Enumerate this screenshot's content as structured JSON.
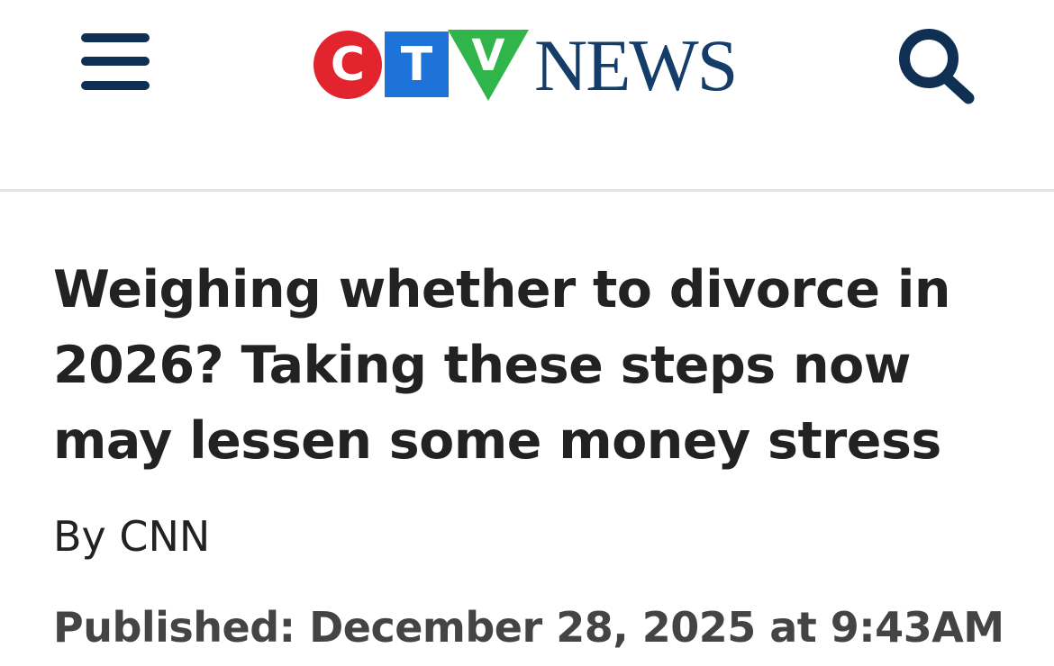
{
  "header": {
    "brand": {
      "c": "C",
      "t": "T",
      "v": "V",
      "word": "NEWS",
      "colors": {
        "c": "#e2242e",
        "t": "#1d73d8",
        "v": "#2fb54a",
        "word": "#153d6a"
      }
    },
    "menu_icon": "hamburger-menu-icon",
    "search_icon": "search-icon"
  },
  "article": {
    "headline": "Weighing whether to divorce in 2026? Taking these steps now may lessen some money stress",
    "byline": "By CNN",
    "published": "Published: December 28, 2025 at 9:43AM"
  },
  "colors": {
    "nav_icon": "#0f3053",
    "headline": "#222222",
    "meta": "#444444",
    "divider": "#e3e3e3"
  }
}
